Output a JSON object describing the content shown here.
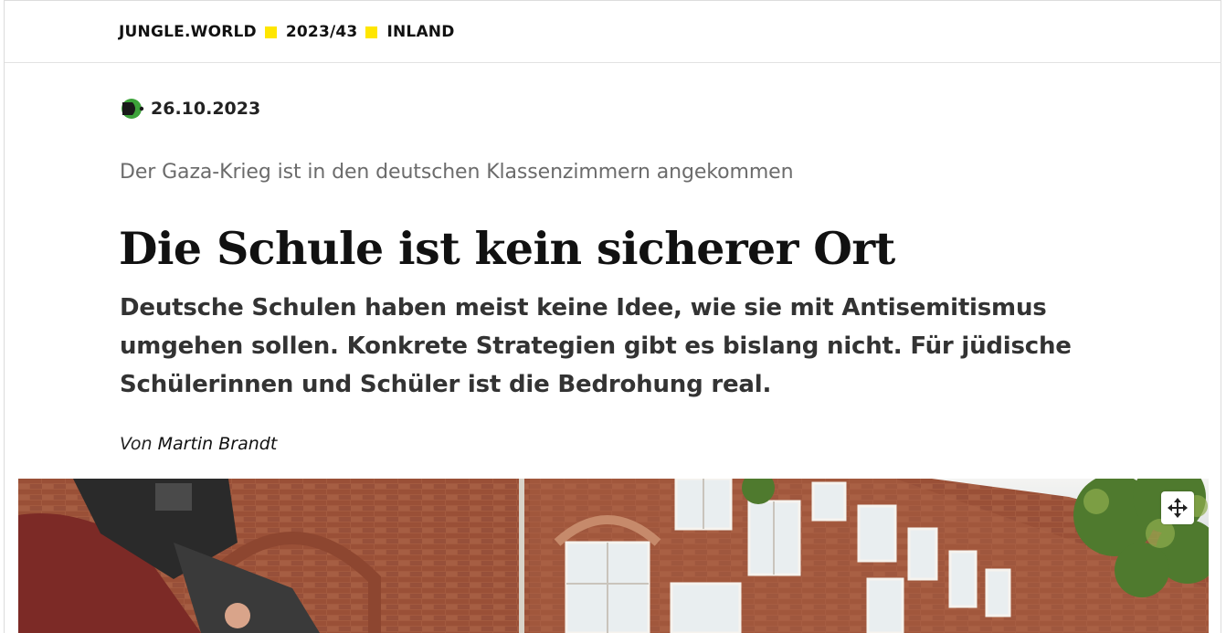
{
  "breadcrumb": {
    "items": [
      "JUNGLE.WORLD",
      "2023/43",
      "INLAND"
    ],
    "separator_color": "#ffe600"
  },
  "article": {
    "issue_icon": "jungle-issue-logo-icon",
    "date": "26.10.2023",
    "kicker": "Der Gaza-Krieg ist in den deutschen Klassenzimmern angekommen",
    "headline": "Die Schule ist kein sicherer Ort",
    "lead": "Deutsche Schulen haben meist keine Idee, wie sie mit Antisemitismus umgehen sollen. Konkrete Strategien gibt es bislang nicht. Für jüdische Schülerinnen und Schüler ist die Bedrohung real.",
    "byline_prefix": "Von",
    "author": "Martin Brandt"
  },
  "hero_image": {
    "control_icon": "move-arrows-icon"
  },
  "colors": {
    "accent_yellow": "#ffe600",
    "icon_green": "#3da33a",
    "brick": "#a0553b",
    "kicker_gray": "#6b6b6b"
  }
}
